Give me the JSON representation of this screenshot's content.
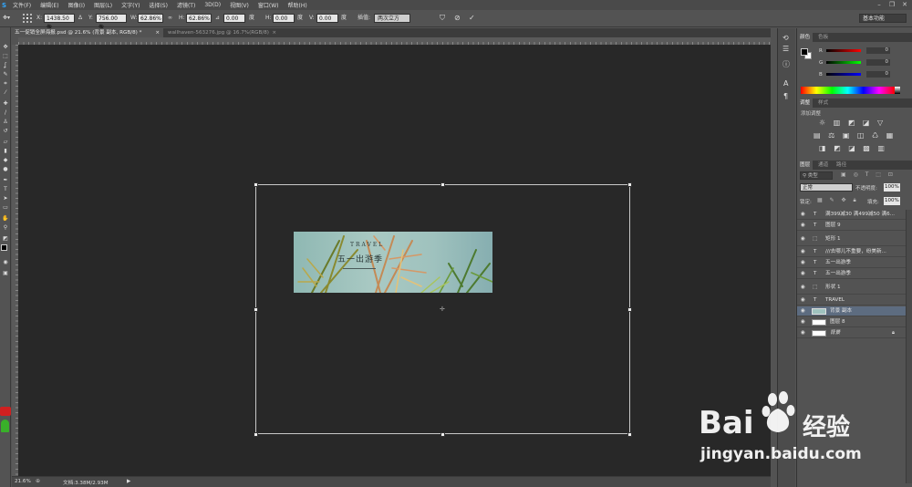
{
  "menubar": {
    "items": [
      "文件(F)",
      "编辑(E)",
      "图像(I)",
      "图层(L)",
      "文字(Y)",
      "选择(S)",
      "滤镜(T)",
      "3D(D)",
      "视图(V)",
      "窗口(W)",
      "帮助(H)"
    ]
  },
  "options": {
    "x_label": "X:",
    "x_value": "1438.50 像",
    "y_label": "Y:",
    "y_value": "756.00 像",
    "w_label": "W:",
    "w_value": "62.86%",
    "h_label": "H:",
    "h_value": "62.86%",
    "angle_value": "0.00",
    "angle_unit": "度",
    "hskew_label": "H:",
    "hskew_value": "0.00",
    "hskew_unit": "度",
    "vskew_label": "V:",
    "vskew_value": "0.00",
    "vskew_unit": "度",
    "interp_label": "插值:",
    "interp_value": "两次立方",
    "workspace": "基本功能"
  },
  "tabs": [
    {
      "label": "五一促销全屏海报.psd @ 21.6% (背景 副本, RGB/8) *",
      "active": true
    },
    {
      "label": "wallhaven-563276.jpg @ 16.7%(RGB/8)",
      "active": false
    }
  ],
  "banner": {
    "title": "TRAVEL",
    "subtitle": "五一出游季"
  },
  "status": {
    "zoom": "21.6%",
    "doc": "文档:3.38M/2.93M"
  },
  "color_panel": {
    "tabs": [
      "颜色",
      "色板"
    ],
    "r": "0",
    "g": "0",
    "b": "0",
    "r_label": "R",
    "g_label": "G",
    "b_label": "B"
  },
  "adjust_panel": {
    "tabs": [
      "调整",
      "样式"
    ],
    "add_label": "添加调整"
  },
  "layers_panel": {
    "tabs": [
      "图层",
      "通道",
      "路径"
    ],
    "filter_label": "类型",
    "mode": "正常",
    "opacity_label": "不透明度:",
    "opacity": "100%",
    "lock_label": "锁定:",
    "fill_label": "填充:",
    "fill": "100%",
    "layers": [
      {
        "name": "满399减30 满499减50 满6...",
        "kind": "text",
        "selected": false
      },
      {
        "name": "图层 9",
        "kind": "text",
        "selected": false
      },
      {
        "name": "矩形 1",
        "kind": "shape",
        "selected": false
      },
      {
        "name": "///去哪儿不重要，纷美新...",
        "kind": "text",
        "selected": false
      },
      {
        "name": "五一出游季",
        "kind": "text",
        "selected": false
      },
      {
        "name": "五一出游季",
        "kind": "text",
        "selected": false
      },
      {
        "name": "形状 1",
        "kind": "shape",
        "selected": false
      },
      {
        "name": "TRAVEL",
        "kind": "text",
        "selected": false
      },
      {
        "name": "背景 副本",
        "kind": "image",
        "selected": true
      },
      {
        "name": "图层 8",
        "kind": "image",
        "selected": false
      },
      {
        "name": "背景",
        "kind": "bg",
        "selected": false
      }
    ]
  },
  "watermark": {
    "brand": "Bai",
    "brand2": "经验",
    "url": "jingyan.baidu.com"
  },
  "colors": {
    "canvas": "#282828",
    "ui": "#535353",
    "selected_layer": "#5d6c80",
    "baidu_blue": "#2f6fde"
  }
}
